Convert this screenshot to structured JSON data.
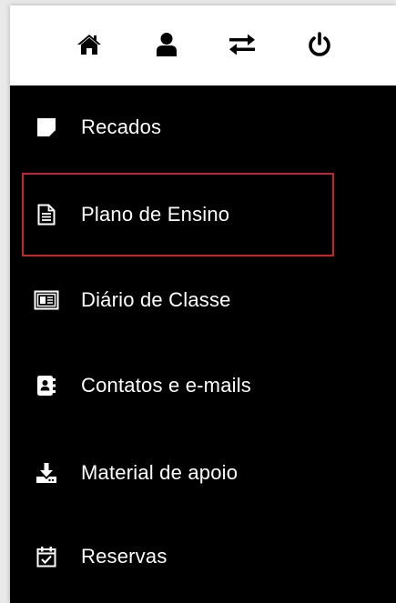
{
  "top_icons": [
    {
      "name": "home-icon"
    },
    {
      "name": "user-icon"
    },
    {
      "name": "switch-icon"
    },
    {
      "name": "power-icon"
    }
  ],
  "menu": {
    "items": [
      {
        "label": "Recados",
        "icon": "note-icon"
      },
      {
        "label": "Plano de Ensino",
        "icon": "document-icon",
        "highlighted": true
      },
      {
        "label": "Diário de Classe",
        "icon": "id-card-icon"
      },
      {
        "label": "Contatos e e-mails",
        "icon": "address-book-icon"
      },
      {
        "label": "Material de apoio",
        "icon": "download-icon"
      },
      {
        "label": "Reservas",
        "icon": "calendar-check-icon"
      }
    ]
  },
  "colors": {
    "panel": "#000000",
    "topbar": "#ffffff",
    "text": "#ffffff",
    "highlight": "#c0262d"
  }
}
